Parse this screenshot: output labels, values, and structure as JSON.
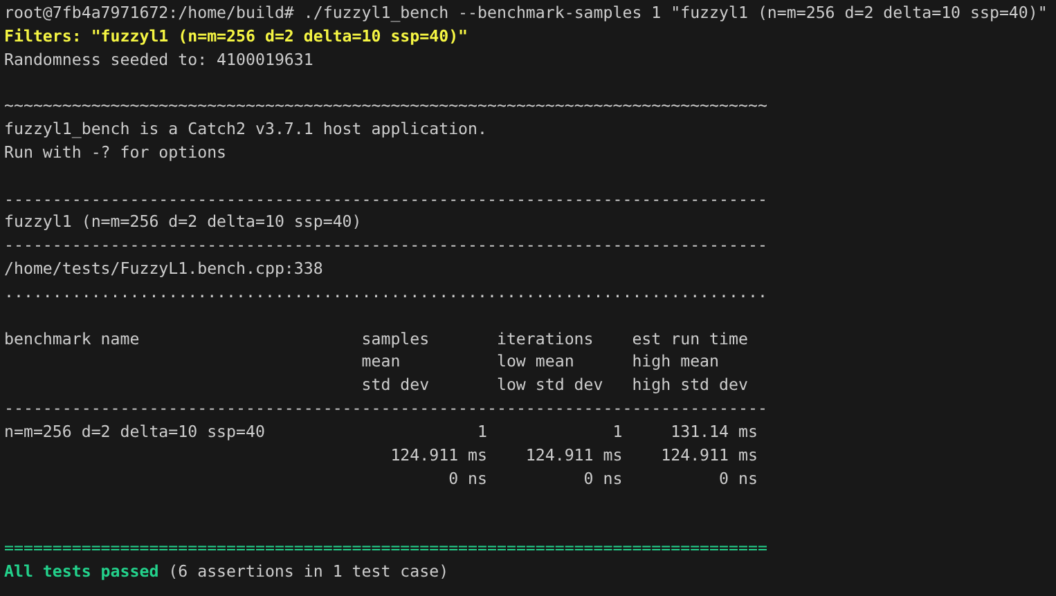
{
  "terminal": {
    "output_before": [
      {
        "kind": "text",
        "color": "#cccccc",
        "bold": false,
        "text": "root@7fb4a7971672:/home/build# ./fuzzyl1_bench --benchmark-samples 1 \"fuzzyl1 (n=m=256 d=2 delta=10 ssp=40)\""
      },
      {
        "kind": "text",
        "color": "#f5f543",
        "bold": true,
        "text": "Filters: \"fuzzyl1 (n=m=256 d=2 delta=10 ssp=40)\""
      },
      {
        "kind": "text",
        "color": "#cccccc",
        "bold": false,
        "text": "Randomness seeded to: 4100019631"
      },
      {
        "kind": "blank"
      },
      {
        "kind": "rule",
        "color": "#cccccc",
        "bold": false,
        "text": "~~~~~~~~~~~~~~~~~~~~~~~~~~~~~~~~~~~~~~~~~~~~~~~~~~~~~~~~~~~~~~~~~~~~~~~~~~~~~~~"
      },
      {
        "kind": "text",
        "color": "#cccccc",
        "bold": false,
        "text": "fuzzyl1_bench is a Catch2 v3.7.1 host application."
      },
      {
        "kind": "text",
        "color": "#cccccc",
        "bold": false,
        "text": "Run with -? for options"
      },
      {
        "kind": "blank"
      },
      {
        "kind": "rule",
        "color": "#cccccc",
        "bold": false,
        "text": "-------------------------------------------------------------------------------"
      },
      {
        "kind": "text",
        "color": "#cccccc",
        "bold": false,
        "text": "fuzzyl1 (n=m=256 d=2 delta=10 ssp=40)"
      },
      {
        "kind": "rule",
        "color": "#cccccc",
        "bold": false,
        "text": "-------------------------------------------------------------------------------"
      },
      {
        "kind": "text",
        "color": "#cccccc",
        "bold": false,
        "text": "/home/tests/FuzzyL1.bench.cpp:338"
      },
      {
        "kind": "rule",
        "color": "#cccccc",
        "bold": false,
        "text": "..............................................................................."
      },
      {
        "kind": "blank"
      }
    ],
    "benchmark_table": {
      "name_heading": "benchmark name",
      "stat_columns": [
        {
          "headings": [
            "samples",
            "mean",
            "std dev"
          ]
        },
        {
          "headings": [
            "iterations",
            "low mean",
            "low std dev"
          ]
        },
        {
          "headings": [
            "est run time",
            "high mean",
            "high std dev"
          ]
        }
      ],
      "rule": "-------------------------------------------------------------------------------",
      "rows": [
        {
          "name": "n=m=256 d=2 delta=10 ssp=40",
          "values": [
            [
              "1",
              "124.911 ms",
              "0 ns"
            ],
            [
              "1",
              "124.911 ms",
              "0 ns"
            ],
            [
              "131.14 ms",
              "124.911 ms",
              "0 ns"
            ]
          ]
        }
      ]
    },
    "output_after": [
      {
        "kind": "blank"
      },
      {
        "kind": "blank"
      },
      {
        "kind": "rule",
        "color": "#23d18b",
        "bold": false,
        "text": "==============================================================================="
      },
      {
        "kind": "summary",
        "status": "All tests passed",
        "color": "#23d18b",
        "bold": true,
        "text": "(6 assertions in 1 test case)"
      }
    ]
  }
}
